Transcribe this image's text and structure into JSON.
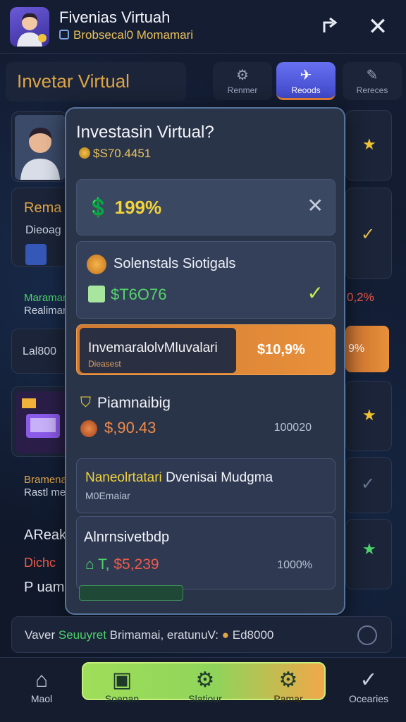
{
  "header": {
    "app_title": "Fivenias Virtuah",
    "app_subtitle": "Brobsecal0 Momamari",
    "share_icon": "share-icon",
    "close_icon": "close-icon"
  },
  "background": {
    "heading": "Invetar Virtual",
    "tabs": [
      {
        "label": "Renmer",
        "icon": "gear-icon"
      },
      {
        "label": "Reoods",
        "icon": "plane-icon"
      },
      {
        "label": "Rereces",
        "icon": "pen-icon"
      }
    ],
    "left_texts": {
      "rema": "Rema",
      "dieo": "Dieoag",
      "maramar": "Maramar",
      "reali": "Realimarr",
      "lal": "Lal800",
      "bramenar": "Bramenar",
      "rastl": "Rastl me",
      "afl": "AReak",
      "dich": "Dichc",
      "p": "P uam"
    },
    "right_texts": {
      "pct1": "0,2%",
      "pct2": "9%"
    }
  },
  "modal": {
    "title": "Investasin Virtual?",
    "balance": "$S70.4451",
    "rate": "199%",
    "stock_name": "Solenstals Siotigals",
    "stock_value": "$T6O76",
    "orange_title": "InvemaralolvMluvalari",
    "orange_sub": "Dieasest",
    "orange_pct": "$10,9%",
    "section_title": "Piamnaibig",
    "section_value": "$,90.43",
    "section_right": "100020",
    "nm_title_yellow": "Naneolrtatari",
    "nm_title_rest": "Dvenisai Mudgma",
    "nm_sub": "M0Emaiar",
    "ar_title": "Alnrnsivetbdp",
    "ar_value_green": "T,",
    "ar_value": "$5,239",
    "ar_right": "1000%"
  },
  "ticker": {
    "text_a": "Vaver",
    "text_green": "Seuuyret",
    "text_b": "Brimamai, eratunuV:",
    "text_c": "Ed8000"
  },
  "nav": {
    "home": "Maol",
    "s": "Soenan",
    "st": "Slatiour",
    "p": "Pamar",
    "o": "Ocearies"
  },
  "colors": {
    "accent_orange": "#e8903a",
    "accent_green": "#9fde5a",
    "accent_blue": "#5660e0"
  }
}
